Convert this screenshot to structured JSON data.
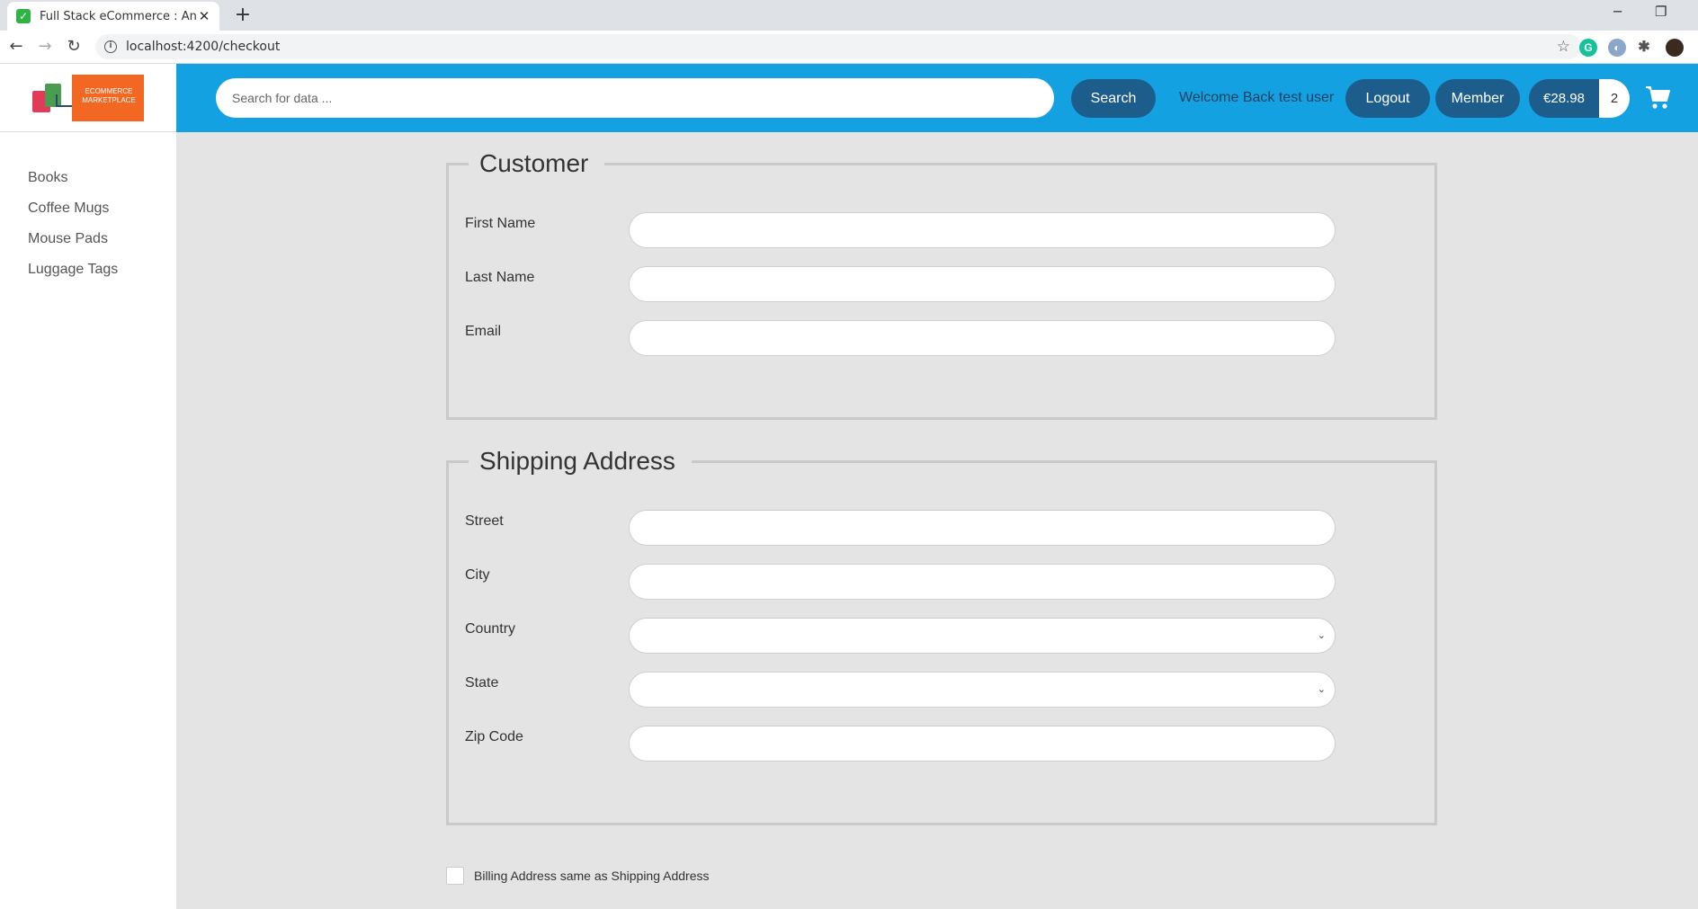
{
  "browser": {
    "tab_title": "Full Stack eCommerce : Angular a",
    "url": "localhost:4200/checkout",
    "new_tab": "+",
    "tab_close": "✕"
  },
  "brand": {
    "logo_text": "ECOMMERCE MARKETPLACE",
    "primary_color": "#14a1e2",
    "button_color": "#1d5d8c"
  },
  "header": {
    "search_placeholder": "Search for data ...",
    "search_button": "Search",
    "welcome": "Welcome Back test user",
    "logout": "Logout",
    "member": "Member",
    "cart_total": "€28.98",
    "cart_quantity": "2"
  },
  "sidebar": {
    "items": [
      {
        "label": "Books"
      },
      {
        "label": "Coffee Mugs"
      },
      {
        "label": "Mouse Pads"
      },
      {
        "label": "Luggage Tags"
      }
    ]
  },
  "customer": {
    "legend": "Customer",
    "fields": [
      {
        "label": "First Name",
        "value": ""
      },
      {
        "label": "Last Name",
        "value": ""
      },
      {
        "label": "Email",
        "value": ""
      }
    ]
  },
  "shipping": {
    "legend": "Shipping Address",
    "fields": [
      {
        "label": "Street",
        "value": ""
      },
      {
        "label": "City",
        "value": ""
      },
      {
        "label": "Country",
        "value": ""
      },
      {
        "label": "State",
        "value": ""
      },
      {
        "label": "Zip Code",
        "value": ""
      }
    ]
  },
  "billing": {
    "checkbox_label": "Billing Address same as Shipping Address",
    "checked": false
  },
  "icons": {
    "favicon": "checkbox-favicon-icon",
    "cart": "shopping-cart-icon"
  }
}
